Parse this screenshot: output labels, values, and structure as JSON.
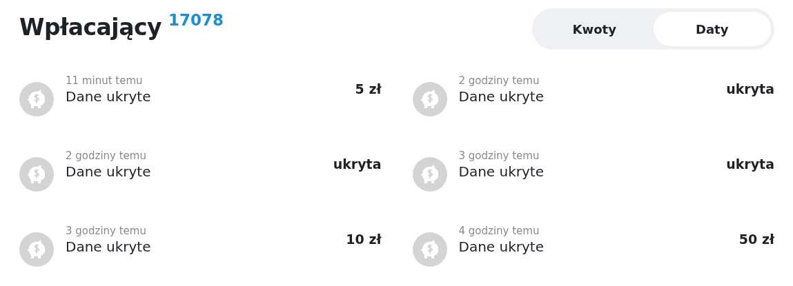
{
  "title": "Wpłacający",
  "count": "17078",
  "tabs": [
    {
      "label": "Kwoty",
      "selected": false
    },
    {
      "label": "Daty",
      "selected": true
    }
  ],
  "donations": [
    {
      "time": "11 minut temu",
      "name": "Dane ukryte",
      "amount": "5 zł"
    },
    {
      "time": "2 godziny temu",
      "name": "Dane ukryte",
      "amount": "ukryta"
    },
    {
      "time": "2 godziny temu",
      "name": "Dane ukryte",
      "amount": "ukryta"
    },
    {
      "time": "3 godziny temu",
      "name": "Dane ukryte",
      "amount": "ukryta"
    },
    {
      "time": "3 godziny temu",
      "name": "Dane ukryte",
      "amount": "10 zł"
    },
    {
      "time": "4 godziny temu",
      "name": "Dane ukryte",
      "amount": "50 zł"
    }
  ]
}
